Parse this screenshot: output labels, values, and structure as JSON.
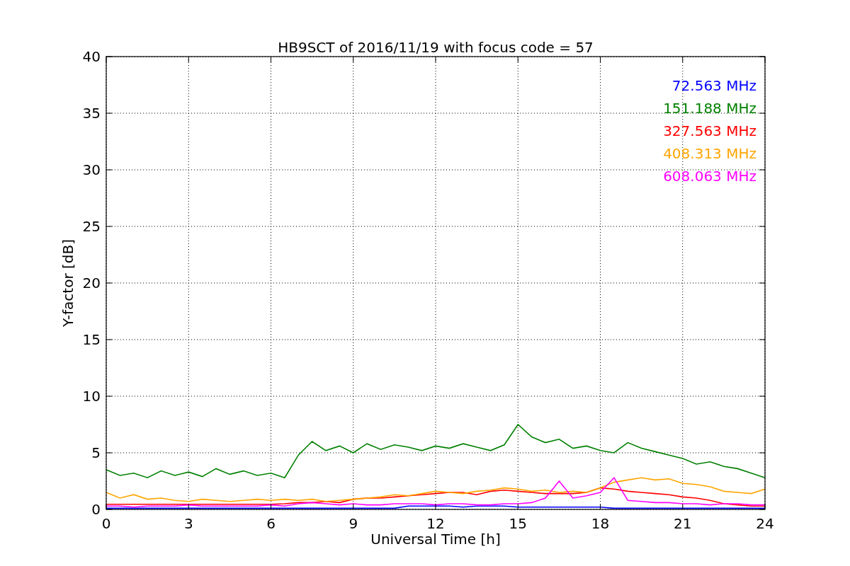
{
  "chart_data": {
    "type": "line",
    "title": "HB9SCT of 2016/11/19 with focus code = 57",
    "xlabel": "Universal Time [h]",
    "ylabel": "Y-factor [dB]",
    "xlim": [
      0,
      24
    ],
    "ylim": [
      0,
      40
    ],
    "xticks": [
      0,
      3,
      6,
      9,
      12,
      15,
      18,
      21,
      24
    ],
    "yticks": [
      0,
      5,
      10,
      15,
      20,
      25,
      30,
      35,
      40
    ],
    "grid": true,
    "x": [
      0,
      0.5,
      1,
      1.5,
      2,
      2.5,
      3,
      3.5,
      4,
      4.5,
      5,
      5.5,
      6,
      6.5,
      7,
      7.5,
      8,
      8.5,
      9,
      9.5,
      10,
      10.5,
      11,
      11.5,
      12,
      12.5,
      13,
      13.5,
      14,
      14.5,
      15,
      15.5,
      16,
      16.5,
      17,
      17.5,
      18,
      18.5,
      19,
      19.5,
      20,
      20.5,
      21,
      21.5,
      22,
      22.5,
      23,
      23.5,
      24
    ],
    "series": [
      {
        "name": "72.563 MHz",
        "color": "#0000ff",
        "values": [
          0.1,
          0.1,
          0.1,
          0.1,
          0.1,
          0.1,
          0.1,
          0.1,
          0.1,
          0.1,
          0.1,
          0.1,
          0.1,
          0.1,
          0.1,
          0.1,
          0.1,
          0.1,
          0.1,
          0.1,
          0.1,
          0.1,
          0.3,
          0.3,
          0.3,
          0.3,
          0.2,
          0.3,
          0.3,
          0.3,
          0.2,
          0.2,
          0.2,
          0.2,
          0.2,
          0.2,
          0.2,
          0.1,
          0.1,
          0.1,
          0.1,
          0.1,
          0.1,
          0.1,
          0.1,
          0.1,
          0.1,
          0.1,
          0.1
        ]
      },
      {
        "name": "151.188 MHz",
        "color": "#008000",
        "values": [
          3.5,
          3.0,
          3.2,
          2.8,
          3.4,
          3.0,
          3.3,
          2.9,
          3.6,
          3.1,
          3.4,
          3.0,
          3.2,
          2.8,
          4.8,
          6.0,
          5.2,
          5.6,
          5.0,
          5.8,
          5.3,
          5.7,
          5.5,
          5.2,
          5.6,
          5.4,
          5.8,
          5.5,
          5.2,
          5.7,
          7.5,
          6.4,
          5.9,
          6.2,
          5.4,
          5.6,
          5.2,
          5.0,
          5.9,
          5.4,
          5.1,
          4.8,
          4.5,
          4.0,
          4.2,
          3.8,
          3.6,
          3.2,
          2.8
        ]
      },
      {
        "name": "327.563 MHz",
        "color": "#ff0000",
        "values": [
          0.45,
          0.45,
          0.45,
          0.45,
          0.45,
          0.45,
          0.45,
          0.45,
          0.45,
          0.45,
          0.45,
          0.45,
          0.45,
          0.5,
          0.6,
          0.6,
          0.7,
          0.6,
          0.9,
          1.0,
          1.0,
          1.1,
          1.2,
          1.3,
          1.4,
          1.5,
          1.5,
          1.3,
          1.6,
          1.7,
          1.6,
          1.5,
          1.4,
          1.4,
          1.4,
          1.5,
          1.9,
          1.8,
          1.6,
          1.5,
          1.4,
          1.3,
          1.1,
          1.0,
          0.8,
          0.5,
          0.4,
          0.3,
          0.3
        ]
      },
      {
        "name": "408.313 MHz",
        "color": "#ffa500",
        "values": [
          1.5,
          1.0,
          1.3,
          0.9,
          1.0,
          0.8,
          0.7,
          0.9,
          0.8,
          0.7,
          0.8,
          0.9,
          0.8,
          0.9,
          0.8,
          0.9,
          0.7,
          0.8,
          0.9,
          1.0,
          1.1,
          1.3,
          1.2,
          1.4,
          1.6,
          1.5,
          1.4,
          1.6,
          1.7,
          1.9,
          1.8,
          1.6,
          1.7,
          1.5,
          1.6,
          1.5,
          1.9,
          2.4,
          2.6,
          2.8,
          2.6,
          2.7,
          2.3,
          2.2,
          2.0,
          1.6,
          1.5,
          1.4,
          1.8
        ]
      },
      {
        "name": "608.063 MHz",
        "color": "#ff00ff",
        "values": [
          0.3,
          0.3,
          0.2,
          0.3,
          0.3,
          0.3,
          0.4,
          0.3,
          0.3,
          0.3,
          0.3,
          0.3,
          0.4,
          0.3,
          0.5,
          0.6,
          0.5,
          0.4,
          0.5,
          0.4,
          0.4,
          0.5,
          0.5,
          0.5,
          0.4,
          0.5,
          0.5,
          0.4,
          0.4,
          0.5,
          0.5,
          0.6,
          1.0,
          2.5,
          1.0,
          1.2,
          1.5,
          2.8,
          0.8,
          0.7,
          0.6,
          0.6,
          0.5,
          0.5,
          0.4,
          0.5,
          0.5,
          0.4,
          0.4
        ]
      }
    ]
  }
}
